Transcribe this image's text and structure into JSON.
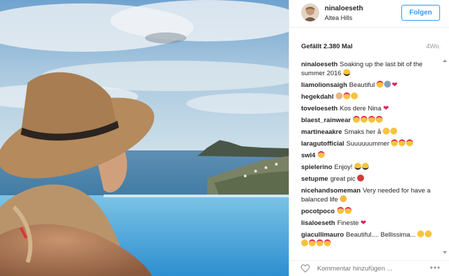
{
  "post": {
    "username": "ninaloeseth",
    "location": "Altea Hills",
    "follow_label": "Folgen",
    "likes": "Gefällt 2.380 Mal",
    "age": "4Wo."
  },
  "comments": [
    {
      "user": "ninaloeseth",
      "text": "Soaking up the last bit of the summer 2016",
      "emoji": [
        "sunglasses"
      ]
    },
    {
      "user": "liamolionsaigh",
      "text": "Beautiful",
      "emoji": [
        "heart-eyes",
        "praying-hands",
        "heart"
      ]
    },
    {
      "user": "hegekdahl",
      "text": "",
      "emoji": [
        "ok-hand",
        "heart-eyes",
        "smile"
      ]
    },
    {
      "user": "toveloeseth",
      "text": "Kos dere Nina",
      "emoji": [
        "heart"
      ]
    },
    {
      "user": "blaest_rainwear",
      "text": "",
      "emoji": [
        "heart-eyes",
        "heart-eyes",
        "heart-eyes",
        "heart-eyes"
      ]
    },
    {
      "user": "martineaakre",
      "text": "Smaks her å",
      "emoji": [
        "yum",
        "yum"
      ]
    },
    {
      "user": "laragutofficial",
      "text": "Suuuuuummer",
      "emoji": [
        "heart-eyes",
        "heart-eyes",
        "heart-eyes"
      ]
    },
    {
      "user": "swl4",
      "text": "",
      "emoji": [
        "heart-eyes"
      ]
    },
    {
      "user": "spielerino",
      "text": "Enjoy!",
      "emoji": [
        "sunglasses",
        "sunglasses"
      ]
    },
    {
      "user": "setupme",
      "text": "great pic",
      "emoji": [
        "lips"
      ]
    },
    {
      "user": "nicehandsomeman",
      "text": "Very needed for have a balanced life",
      "emoji": [
        "thumbs-up"
      ]
    },
    {
      "user": "pocotpoco",
      "text": "",
      "emoji": [
        "heart-eyes",
        "heart-eyes"
      ]
    },
    {
      "user": "lisaloeseth",
      "text": "Fineste",
      "emoji": [
        "heart"
      ]
    },
    {
      "user": "giacullimauro",
      "text": "Beautiful.... Bellissima...",
      "emoji": [
        "yum",
        "yum",
        "yum",
        "heart-eyes",
        "heart-eyes",
        "heart-eyes"
      ]
    }
  ],
  "footer": {
    "comment_placeholder": "Kommentar hinzufügen ...",
    "more_label": "•••"
  },
  "colors": {
    "accent": "#3897f0",
    "heart": "#e0245e",
    "emoji_yellow": "#f7c33f"
  },
  "icons": [
    "heart-outline-icon",
    "more-options-icon",
    "avatar"
  ]
}
